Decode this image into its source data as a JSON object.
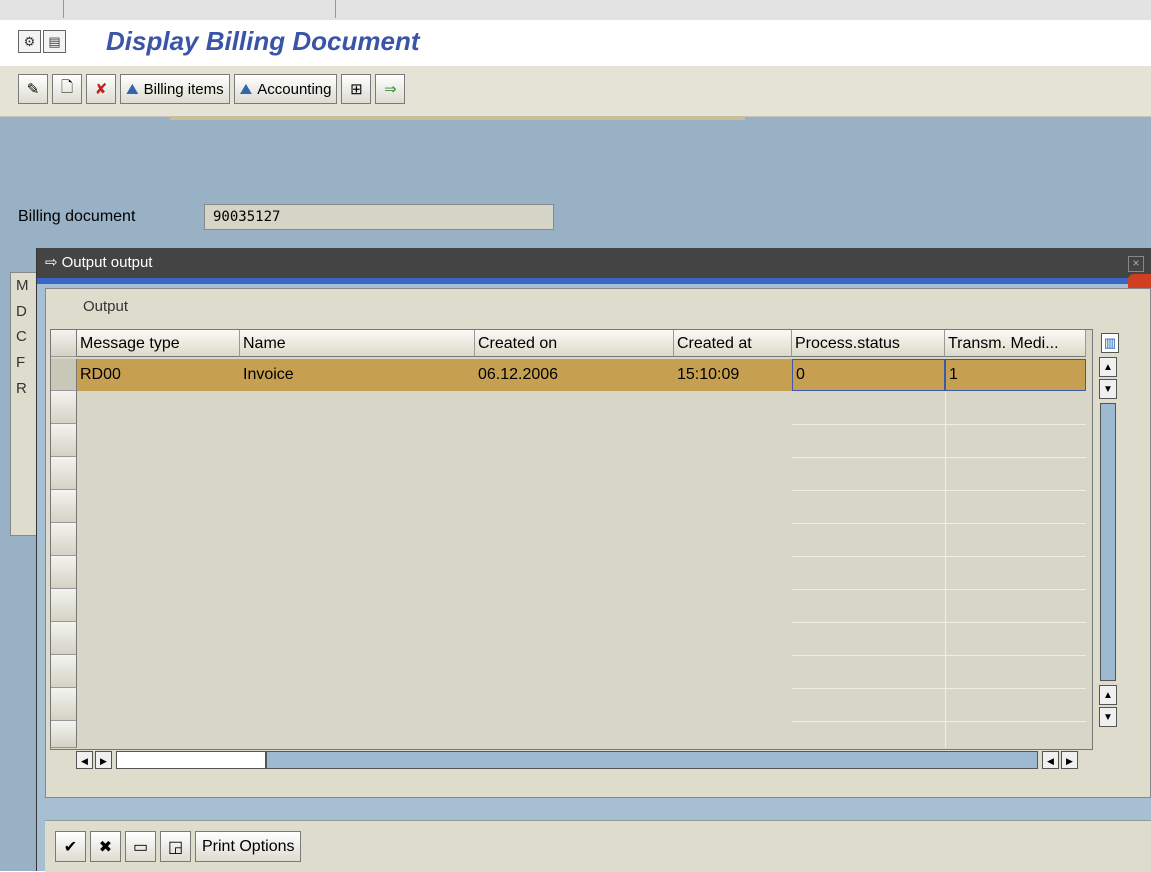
{
  "window": {
    "title": "Display Billing Document",
    "title_icons": [
      "display-icon",
      "page-icon"
    ]
  },
  "toolbar": {
    "items": [
      {
        "id": "change",
        "icon": "pencil-icon",
        "glyph": "✎"
      },
      {
        "id": "create",
        "icon": "document-icon",
        "glyph": "🗋"
      },
      {
        "id": "cancel",
        "icon": "cancel-document-icon",
        "glyph": "✘"
      },
      {
        "id": "billing-items",
        "icon": "people-icon",
        "glyph": "⛰",
        "label": "Billing items"
      },
      {
        "id": "accounting",
        "icon": "people-icon",
        "glyph": "⛰",
        "label": "Accounting"
      },
      {
        "id": "hierarchy",
        "icon": "hierarchy-icon",
        "glyph": "⊞"
      },
      {
        "id": "output",
        "icon": "output-icon",
        "glyph": "⇒"
      }
    ]
  },
  "form": {
    "billing_document_label": "Billing document",
    "billing_document_value": "90035127"
  },
  "background_tabs": [
    "M",
    "D",
    "C",
    "F",
    "R"
  ],
  "dialog": {
    "title": "Output output",
    "title_icon": "dialog-icon",
    "group_label": "Output",
    "columns": [
      "Message type",
      "Name",
      "Created on",
      "Created at",
      "Process.status",
      "Transm. Medi..."
    ],
    "rows": [
      {
        "message_type": "RD00",
        "name": "Invoice",
        "created_on": "06.12.2006",
        "created_at": "15:10:09",
        "process_status": "0",
        "transm_medium": "1"
      }
    ],
    "buttons": [
      {
        "id": "continue",
        "icon": "checkmark-icon",
        "glyph": "✔"
      },
      {
        "id": "cancel",
        "icon": "cancel-icon",
        "glyph": "✖"
      },
      {
        "id": "print-preview",
        "icon": "print-preview-icon",
        "glyph": "▭"
      },
      {
        "id": "communication-method",
        "icon": "communication-icon",
        "glyph": "◲"
      },
      {
        "id": "print-options",
        "label": "Print Options"
      }
    ]
  },
  "colors": {
    "background": "#98b1c5",
    "selected_row": "#c6a050",
    "title_text": "#3a55a8",
    "dialog_title": "#444444"
  }
}
